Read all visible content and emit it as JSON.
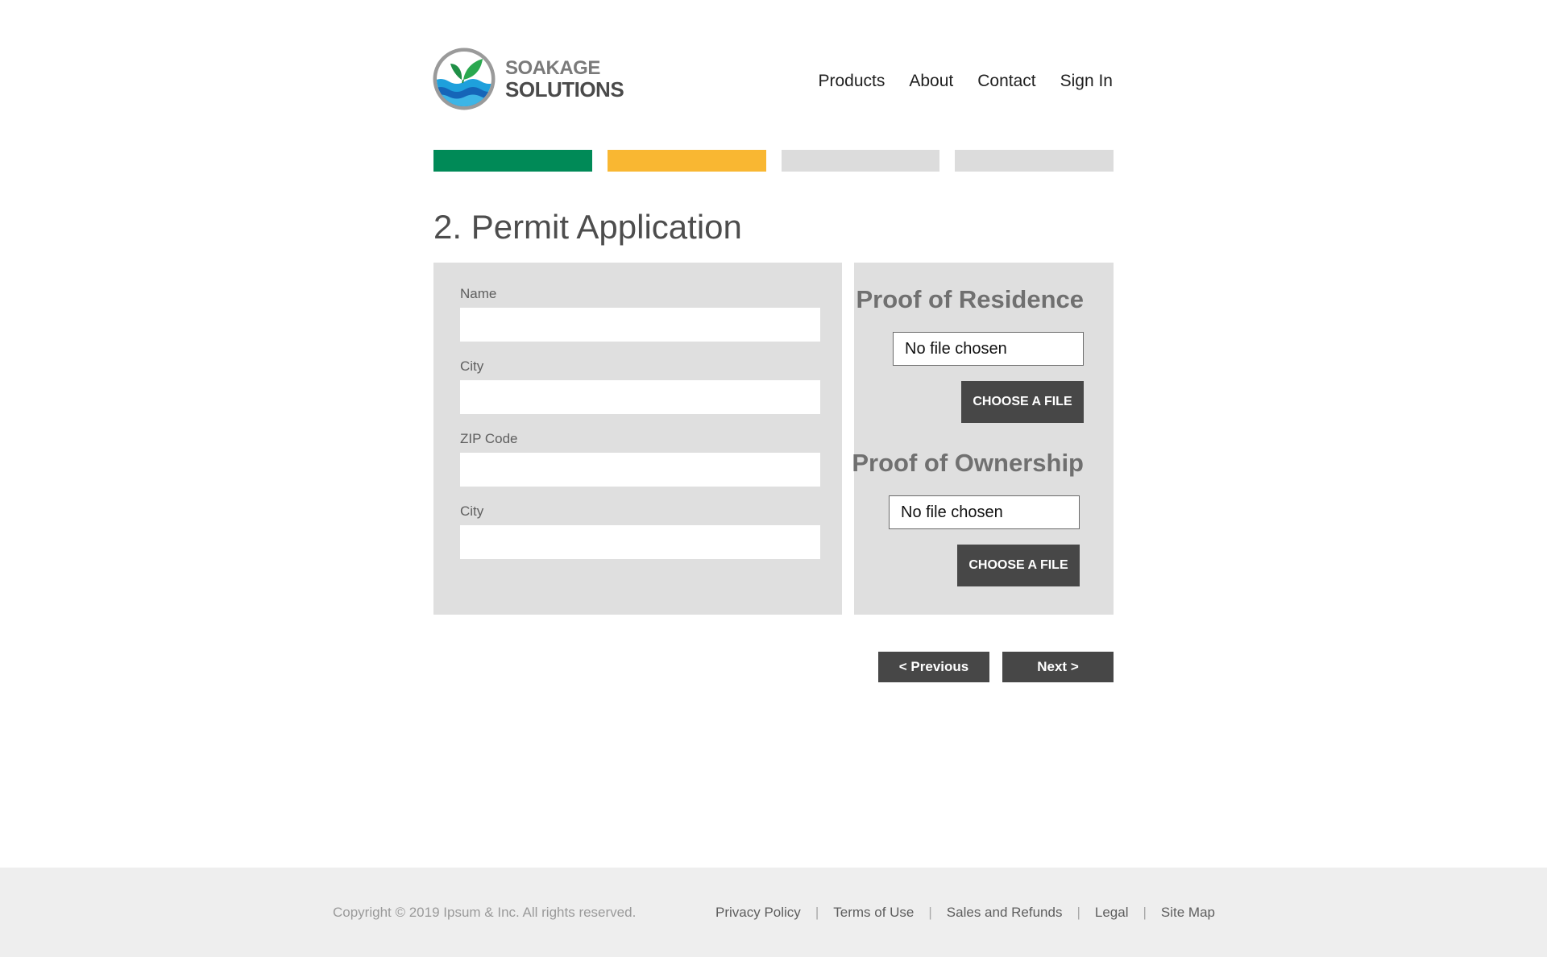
{
  "brand": {
    "name_line1": "SOAKAGE",
    "name_line2": "SOLUTIONS"
  },
  "nav": {
    "items": [
      "Products",
      "About",
      "Contact",
      "Sign In"
    ]
  },
  "progress": {
    "colors": [
      "#008a57",
      "#f9b732",
      "#dcdcdc",
      "#dcdcdc"
    ]
  },
  "page_title": "2. Permit Application",
  "form": {
    "fields": [
      {
        "label": "Name",
        "value": ""
      },
      {
        "label": "City",
        "value": ""
      },
      {
        "label": "ZIP Code",
        "value": ""
      },
      {
        "label": "City",
        "value": ""
      }
    ]
  },
  "uploads": [
    {
      "title": "Proof of Residence",
      "file_status": "No file chosen",
      "button_label": "CHOOSE A FILE"
    },
    {
      "title": "Proof of Ownership",
      "file_status": "No file chosen",
      "button_label": "CHOOSE A FILE"
    }
  ],
  "buttons": {
    "previous": "< Previous",
    "next": "Next >"
  },
  "footer": {
    "copyright": "Copyright © 2019 Ipsum & Inc. All rights reserved.",
    "links": [
      "Privacy Policy",
      "Terms of Use",
      "Sales and Refunds",
      "Legal",
      "Site Map"
    ],
    "separator": "|"
  },
  "colors": {
    "accent_green": "#008a57",
    "accent_yellow": "#f9b732",
    "button_dark": "#474747",
    "panel_gray": "#dfdfdf"
  },
  "icons": {
    "logo": "leaf-over-water-logo-icon"
  }
}
